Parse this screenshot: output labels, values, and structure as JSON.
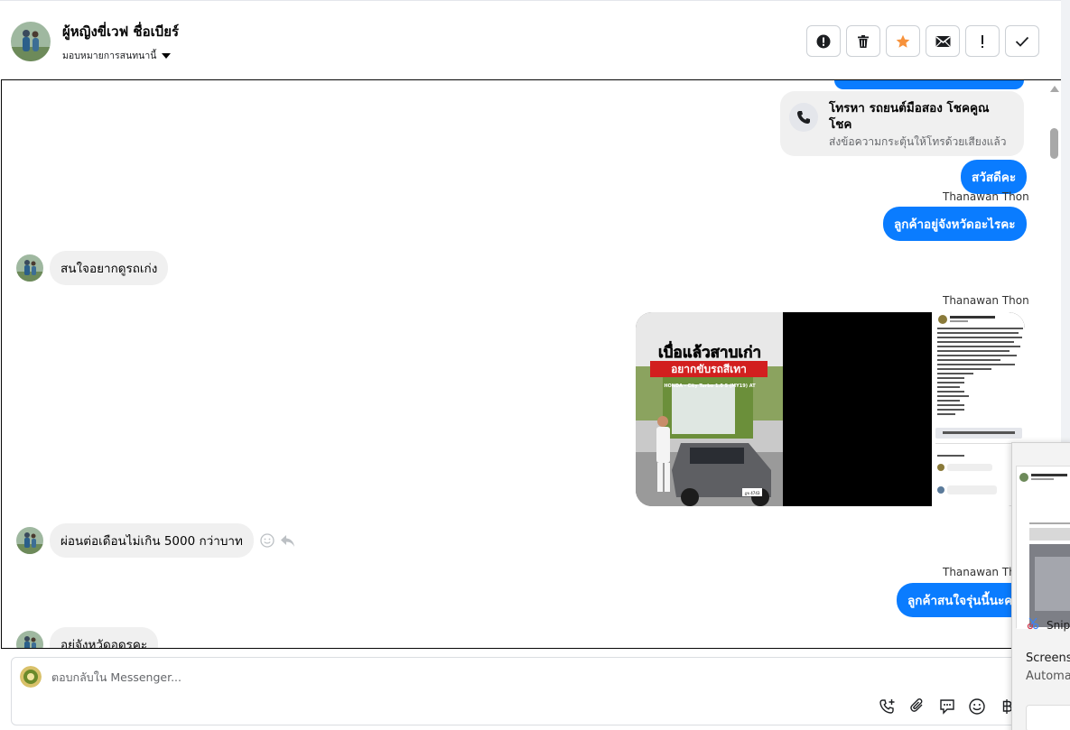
{
  "header": {
    "contact_name": "ผู้หญิงขี่เวฟ ชื่อเบียร์",
    "assign_label": "มอบหมายการสนทนานี้",
    "actions": [
      {
        "name": "spam-button",
        "icon": "alert-circle-icon"
      },
      {
        "name": "delete-button",
        "icon": "trash-icon"
      },
      {
        "name": "star-button",
        "icon": "star-icon"
      },
      {
        "name": "mark-unread-button",
        "icon": "envelope-icon"
      },
      {
        "name": "follow-up-button",
        "icon": "exclamation-icon"
      },
      {
        "name": "done-button",
        "icon": "check-icon"
      }
    ]
  },
  "call": {
    "title": "โทรหา รถยนต์มือสอง โชคคูณ โชค",
    "subtitle": "ส่งข้อความกระตุ้นให้โทรด้วยเสียงแล้ว"
  },
  "messages": [
    {
      "text": "สวัสดีคะ"
    },
    {
      "sender": "Thanawan Thon",
      "text": "ลูกค้าอยู่จังหวัดอะไรคะ"
    },
    {
      "text": "สนใจอยากดูรถเก่ง"
    },
    {
      "sender": "Thanawan Thon"
    },
    {
      "text": "ผ่อนต่อเดือนไม่เกิน 5000 กว่าบาท"
    },
    {
      "sender": "Thanawan Thon",
      "text": "ลูกค้าสนใจรุ่นนี้นะคะ"
    },
    {
      "text": "อยู่จังหวัดอุดรคะ"
    }
  ],
  "image_post": {
    "headline": "เบื่อแล้วสาบเก่า",
    "subheadline": "อยากขับรถสีเทา",
    "model_line": "HONDA - City Turbo 1.0 S (MY19) AT",
    "plate": "ฎข 4743"
  },
  "composer": {
    "placeholder": "ตอบกลับใน Messenger..."
  },
  "popup": {
    "app_name": "Snipping Tool",
    "title": "Screenshot copied to clipboard",
    "subtitle": "Automatically saved to screenshots folder"
  },
  "colors": {
    "outgoing_bubble": "#0a7cff",
    "incoming_bubble": "#f0f0f0",
    "star": "#f7923b"
  }
}
